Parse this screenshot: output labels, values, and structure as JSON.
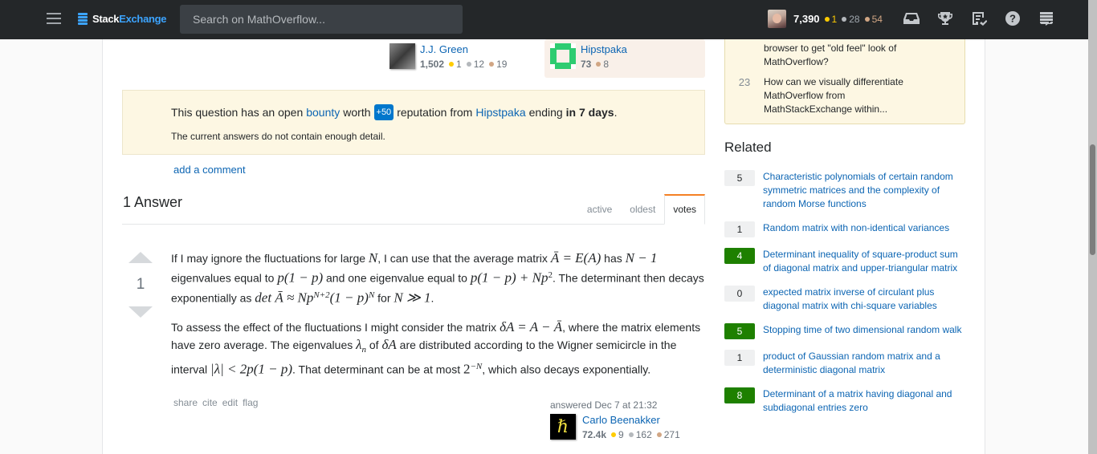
{
  "topbar": {
    "logo_part1": "Stack",
    "logo_part2": "Exchange",
    "search_placeholder": "Search on MathOverflow...",
    "user": {
      "reputation": "7,390",
      "gold": "1",
      "silver": "28",
      "bronze": "54"
    },
    "icons": [
      "inbox-icon",
      "achievements-icon",
      "review-icon",
      "help-icon",
      "site-switcher-icon"
    ]
  },
  "question_signatures": {
    "editor": {
      "name": "J.J. Green",
      "reputation": "1,502",
      "gold": "1",
      "silver": "12",
      "bronze": "19"
    },
    "owner": {
      "name": "Hipstpaka",
      "reputation": "73",
      "bronze": "8"
    }
  },
  "bounty": {
    "text1": "This question has an open",
    "link": "bounty",
    "text2": "worth",
    "amount": "+50",
    "text3": "reputation from",
    "user": "Hipstpaka",
    "text4": "ending",
    "ending": "in 7 days",
    "period": ".",
    "reason": "The current answers do not contain enough detail."
  },
  "add_comment": "add a comment",
  "answers": {
    "count_label": "1 Answer",
    "tabs": [
      {
        "label": "active"
      },
      {
        "label": "oldest"
      },
      {
        "label": "votes",
        "active": true
      }
    ]
  },
  "answer": {
    "score": "1",
    "p1": {
      "a": "If I may ignore the fluctuations for large ",
      "m1": "N",
      "b": ", I can use that the average matrix ",
      "m2": "Ā = E(A)",
      "c": " has ",
      "m3": "N − 1",
      "d": " eigenvalues equal to ",
      "m4": "p(1 − p)",
      "e": " and one eigenvalue equal to ",
      "m5": "p(1 − p) + Np",
      "m5sup": "2",
      "f": ". The determinant then decays exponentially as ",
      "m6": "det Ā ≈ Np",
      "m6sup": "N+2",
      "m7": "(1 − p)",
      "m7sup": "N",
      "g": " for ",
      "m8": "N ≫ 1",
      "h": "."
    },
    "p2": {
      "a": "To assess the effect of the fluctuations I might consider the matrix ",
      "m1": "δA = A − Ā",
      "b": ", where the matrix elements have zero average. The eigenvalues ",
      "m2": "λ",
      "m2sub": "n",
      "c": " of ",
      "m3": "δA",
      "d": " are distributed according to the Wigner semicircle in the interval ",
      "m4": "|λ| < 2p(1 − p)",
      "e": ". That determinant can be at most ",
      "m5": "2",
      "m5sup": "−N",
      "f": ", which also decays exponentially."
    },
    "menu": [
      "share",
      "cite",
      "edit",
      "flag"
    ],
    "answered": "answered Dec 7 at 21:32",
    "author": {
      "name": "Carlo Beenakker",
      "reputation": "72.4k",
      "gold": "9",
      "silver": "162",
      "bronze": "271",
      "avatar_glyph": "ℏ"
    }
  },
  "meta_box": {
    "items": [
      {
        "text": "browser to get \"old feel\" look of MathOverflow?"
      },
      {
        "count": "23",
        "text": "How can we visually differentiate MathOverflow from MathStackExchange within..."
      }
    ]
  },
  "related": {
    "title": "Related",
    "items": [
      {
        "score": "5",
        "answered": false,
        "title": "Characteristic polynomials of certain random symmetric matrices and the complexity of random Morse functions"
      },
      {
        "score": "1",
        "answered": false,
        "title": "Random matrix with non-identical variances"
      },
      {
        "score": "4",
        "answered": true,
        "title": "Determinant inequality of square-product sum of diagonal matrix and upper-triangular matrix"
      },
      {
        "score": "0",
        "answered": false,
        "title": "expected matrix inverse of circulant plus diagonal matrix with chi-square variables"
      },
      {
        "score": "5",
        "answered": true,
        "title": "Stopping time of two dimensional random walk"
      },
      {
        "score": "1",
        "answered": false,
        "title": "product of Gaussian random matrix and a deterministic diagonal matrix"
      },
      {
        "score": "8",
        "answered": true,
        "title": "Determinant of a matrix having diagonal and subdiagonal entries zero"
      }
    ]
  },
  "colors": {
    "topbar_bg": "#242729",
    "link": "#0c65b3",
    "accent_orange": "#f48024",
    "bounty_bg": "#fdf7e3",
    "bounty_pill": "#0077cc",
    "answered_green": "#1e8000"
  }
}
